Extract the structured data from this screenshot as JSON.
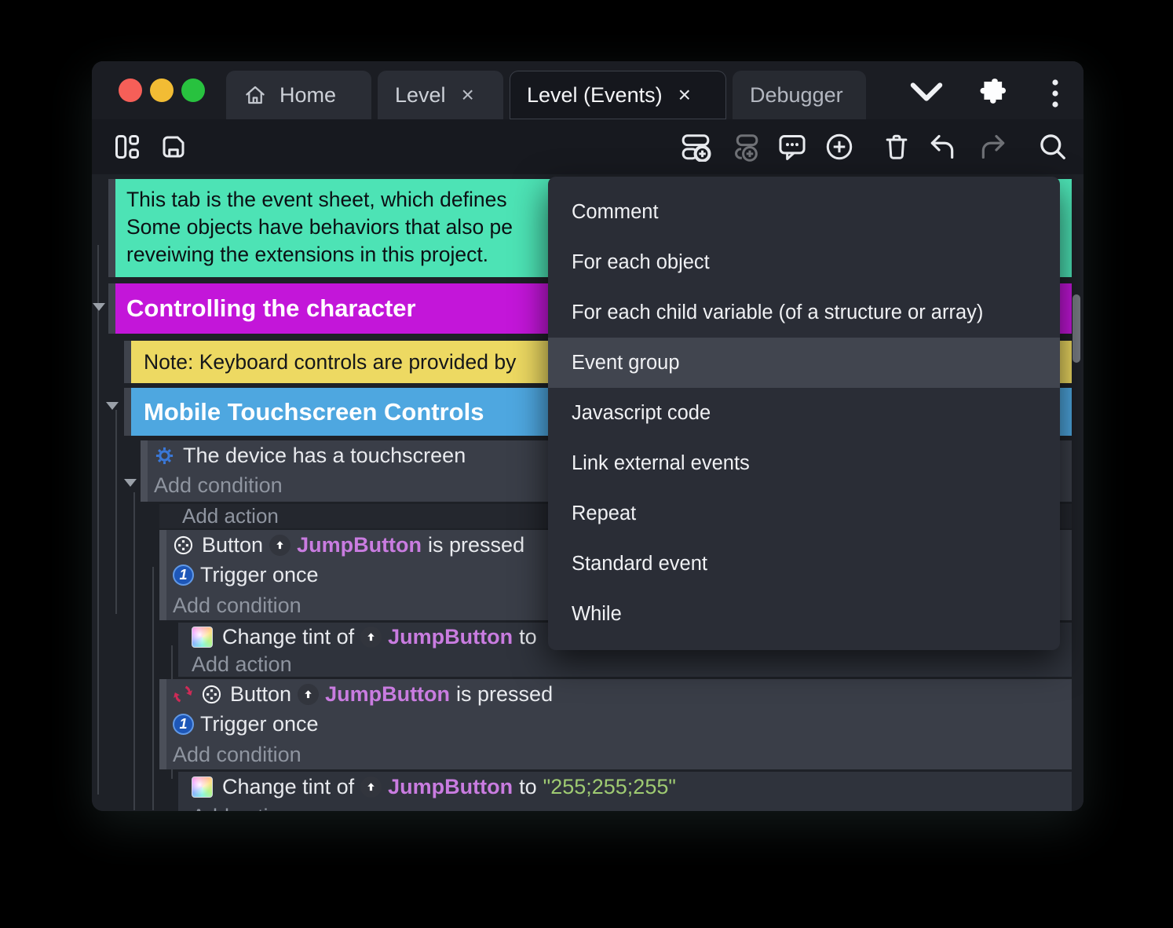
{
  "titlebar": {
    "tabs": {
      "home": "Home",
      "level": "Level",
      "level_events": "Level (Events)",
      "debugger": "Debugger"
    },
    "close_glyph": "×"
  },
  "toolbar": {
    "icon_names": [
      "split-view",
      "save",
      "play",
      "play-dropdown",
      "preview-globe",
      "add-event",
      "add-subevent",
      "add-comment",
      "add-new",
      "delete",
      "undo",
      "redo",
      "search"
    ],
    "accent_purple": "#5a2fd9"
  },
  "sheet": {
    "comment_line1": "This tab is the event sheet, which defines",
    "comment_line2": "Some objects have behaviors that also pe",
    "comment_line3": "reveiwing the extensions in this project.",
    "group_controlling": "Controlling the character",
    "note": "Note: Keyboard controls are provided by",
    "group_mobile": "Mobile Touchscreen Controls",
    "touch_condition": "The device has a touchscreen",
    "add_condition": "Add condition",
    "add_action": "Add action",
    "button_object": "Button",
    "instance_name": "JumpButton",
    "is_pressed": "is pressed",
    "trigger_once": "Trigger once",
    "change_tint": "Change tint of",
    "to_word": "to",
    "tint_value": "\"255;255;255\"",
    "colors": {
      "comment_green": "#4de3b5",
      "group_magenta": "#c316d9",
      "note_yellow": "#edd962",
      "group_blue": "#4ea7e0",
      "instance_purple": "#c97ce0",
      "string_green": "#9fcb72"
    }
  },
  "menu": {
    "items": [
      "Comment",
      "For each object",
      "For each child variable (of a structure or array)",
      "Event group",
      "Javascript code",
      "Link external events",
      "Repeat",
      "Standard event",
      "While"
    ],
    "highlighted": "Event group"
  }
}
